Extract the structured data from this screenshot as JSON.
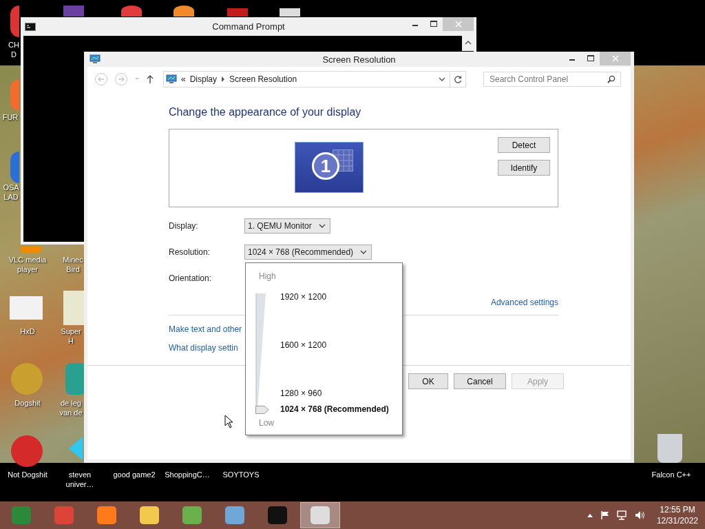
{
  "command_prompt": {
    "title": "Command Prompt"
  },
  "window": {
    "title": "Screen Resolution",
    "breadcrumb": {
      "overflow": "«",
      "items": [
        "Display",
        "Screen Resolution"
      ]
    },
    "search": {
      "placeholder": "Search Control Panel"
    },
    "heading": "Change the appearance of your display",
    "monitor": {
      "number": "1"
    },
    "side_buttons": [
      {
        "label": "Detect"
      },
      {
        "label": "Identify"
      }
    ],
    "fields": [
      {
        "label": "Display:",
        "value": "1. QEMU Monitor"
      },
      {
        "label": "Resolution:",
        "value": "1024 × 768 (Recommended)"
      },
      {
        "label": "Orientation:"
      }
    ],
    "advanced_link": "Advanced settings",
    "links": [
      "Make text and other",
      "What display settin"
    ],
    "buttons": [
      {
        "label": "OK",
        "disabled": false
      },
      {
        "label": "Cancel",
        "disabled": false
      },
      {
        "label": "Apply",
        "disabled": true
      }
    ],
    "resolution_popup": {
      "high": "High",
      "low": "Low",
      "level": 0,
      "options": [
        {
          "label": "1920 × 1200",
          "selected": false
        },
        {
          "label": "1600 × 1200",
          "selected": false
        },
        {
          "label": "1280 × 960",
          "selected": false
        },
        {
          "label": "1024 × 768 (Recommended)",
          "selected": true
        }
      ]
    }
  },
  "desktop_icons": [
    {
      "label": "CH\nD"
    },
    {
      "label": "FUR"
    },
    {
      "label": "OSA\nLAD"
    },
    {
      "label": "VLC media\nplayer"
    },
    {
      "label": "HxD"
    },
    {
      "label": "Dogshit"
    },
    {
      "label": "Not Dogshit"
    },
    {
      "label": "Minec\nBird"
    },
    {
      "label": "Super H"
    },
    {
      "label": "de leg\nvan de"
    },
    {
      "label": "steven\nuniver…"
    },
    {
      "label": "good game2"
    },
    {
      "label": "ShoppingC…"
    },
    {
      "label": "SOYTOYS"
    },
    {
      "label": "Falcon C++"
    }
  ],
  "taskbar": {
    "apps": [
      {
        "active": false
      },
      {
        "active": false
      },
      {
        "active": false
      },
      {
        "active": false
      },
      {
        "active": false
      },
      {
        "active": false
      },
      {
        "active": false
      },
      {
        "active": true
      }
    ],
    "time": "12:55 PM",
    "date": "12/31/2022"
  }
}
